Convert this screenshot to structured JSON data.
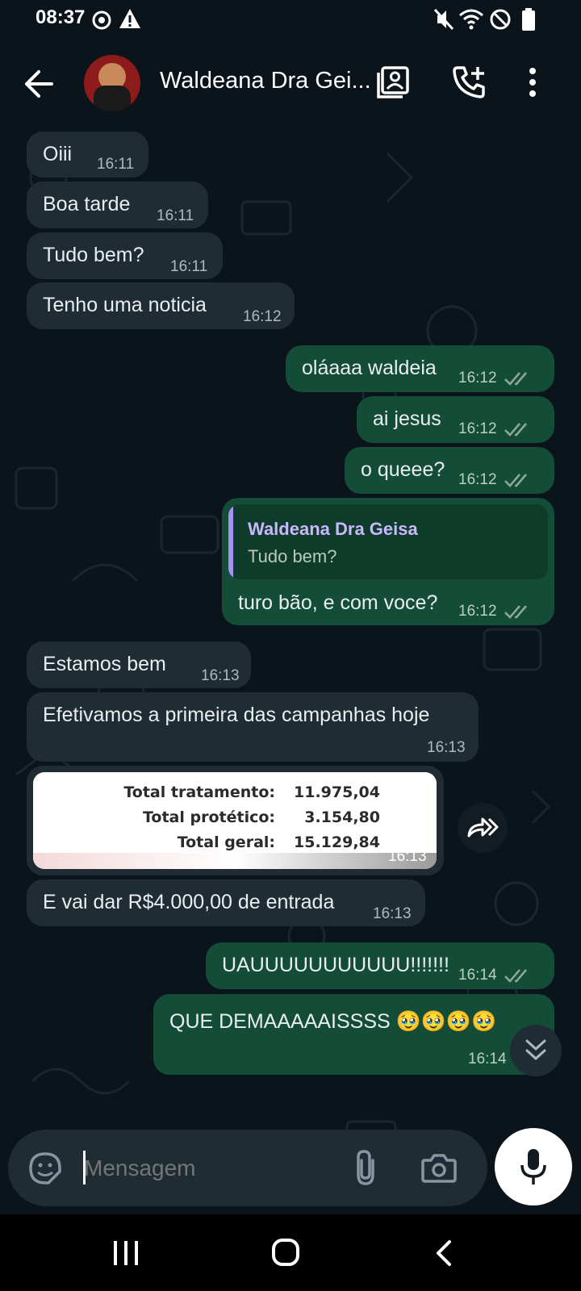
{
  "status_bar": {
    "time": "08:37"
  },
  "header": {
    "contact_name": "Waldeana Dra Gei..."
  },
  "messages": [
    {
      "dir": "in",
      "text": "Oiii",
      "time": "16:11"
    },
    {
      "dir": "in",
      "text": "Boa tarde",
      "time": "16:11"
    },
    {
      "dir": "in",
      "text": "Tudo bem?",
      "time": "16:11"
    },
    {
      "dir": "in",
      "text": "Tenho uma noticia",
      "time": "16:12"
    },
    {
      "dir": "out",
      "text": "oláaaa waldeia",
      "time": "16:12"
    },
    {
      "dir": "out",
      "text": "ai jesus",
      "time": "16:12"
    },
    {
      "dir": "out",
      "text": "o queee?",
      "time": "16:12"
    },
    {
      "dir": "out",
      "reply_author": "Waldeana Dra Geisa",
      "reply_text": "Tudo bem?",
      "text": "turo bão, e com voce?",
      "time": "16:12"
    },
    {
      "dir": "in",
      "text": "Estamos bem",
      "time": "16:13"
    },
    {
      "dir": "in",
      "text": "Efetivamos a primeira das campanhas hoje",
      "time": "16:13"
    },
    {
      "dir": "in",
      "type": "image",
      "time": "16:13",
      "image_lines": [
        {
          "label": "Total tratamento:",
          "value": "11.975,04"
        },
        {
          "label": "Total protético:",
          "value": "3.154,80"
        },
        {
          "label": "Total geral:",
          "value": "15.129,84"
        }
      ]
    },
    {
      "dir": "in",
      "text": "E vai dar R$4.000,00 de entrada",
      "time": "16:13"
    },
    {
      "dir": "out",
      "text": "UAUUUUUUUUUUU!!!!!!!",
      "time": "16:14"
    },
    {
      "dir": "out",
      "text": "QUE DEMAAAAAISSSS 🥹🥹🥹🥹",
      "time": "16:14"
    }
  ],
  "composer": {
    "placeholder": "Mensagem"
  }
}
